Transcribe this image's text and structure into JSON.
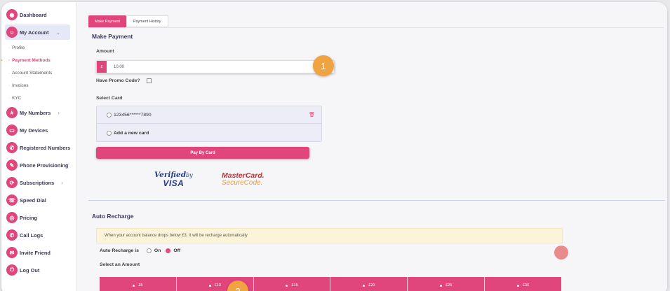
{
  "sidebar": {
    "dashboard": "Dashboard",
    "my_account": "My Account",
    "sub_items": [
      "Profile",
      "Payment Methods",
      "Account Statements",
      "Invoices",
      "KYC"
    ],
    "items": [
      "My Numbers",
      "My Devices",
      "Registered Numbers",
      "Phone Provisioning",
      "Subscriptions",
      "Speed Dial",
      "Pricing",
      "Call Logs",
      "Invite Friend",
      "Log Out"
    ]
  },
  "tabs": {
    "make_payment": "Make Payment",
    "payment_history": "Payment History"
  },
  "payment": {
    "title": "Make Payment",
    "amount_label": "Amount",
    "currency": "£",
    "amount_value": "10.00",
    "promo_label": "Have Promo Code?",
    "select_card_label": "Select Card",
    "card_number": "123456******7890",
    "add_card": "Add a new card",
    "pay_button": "Pay By Card"
  },
  "logos": {
    "visa_line1": "Verified",
    "visa_by": "by",
    "visa_line2": "VISA",
    "mc_line1": "MasterCard.",
    "mc_line2": "SecureCode."
  },
  "auto_recharge": {
    "title": "Auto Recharge",
    "notice": "When your account balance drops below £3, It will be recharge automatically",
    "status_label": "Auto Recharge is",
    "on": "On",
    "off": "Off",
    "selected": "Off",
    "select_amount_label": "Select an Amount",
    "amounts": [
      "£5",
      "£10",
      "£15",
      "£20",
      "£25",
      "£30"
    ]
  },
  "annotations": {
    "step1": "1",
    "step2": "2"
  },
  "colors": {
    "accent": "#e0457b",
    "badge": "#f1a342",
    "notice_bg": "#fbf4d8",
    "active_nav": "#e4e8f7"
  }
}
